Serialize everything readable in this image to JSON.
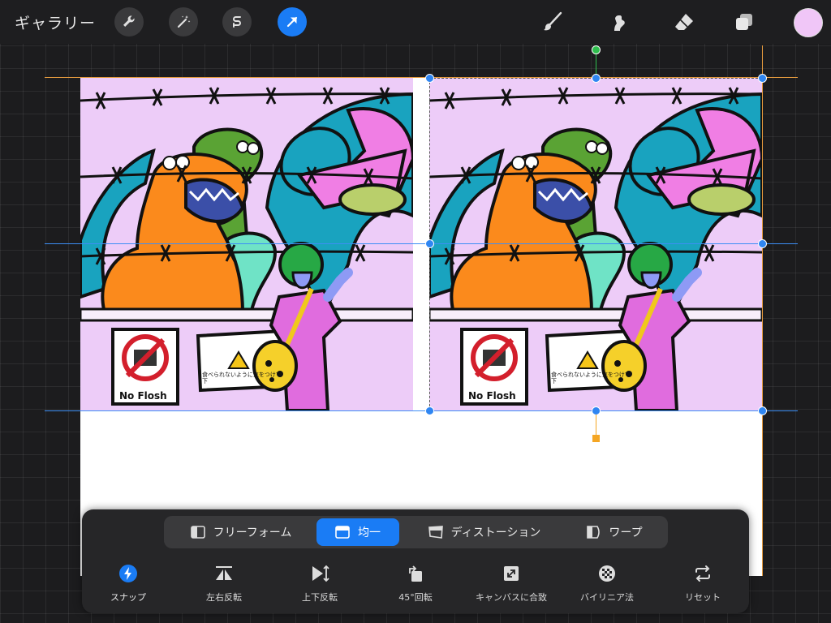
{
  "topbar": {
    "gallery_label": "ギャラリー",
    "tools_left": [
      "wrench-icon",
      "magic-wand-icon",
      "selection-s-icon",
      "arrow-transform-icon"
    ],
    "tools_right": [
      "brush-icon",
      "smudge-icon",
      "eraser-icon",
      "layers-icon"
    ],
    "active_tool": "arrow-transform-icon",
    "color_swatch": "#f0c6f7",
    "accent": "#1a7cf5"
  },
  "canvas": {
    "left_panel": {
      "sign_no_flash": "No Flosh",
      "sign_warning": "食べられないように気をつけて下"
    },
    "right_panel": {
      "sign_no_flash": "No Flosh",
      "sign_warning": "食べられないように気をつけて下"
    }
  },
  "transform": {
    "modes": [
      {
        "label": "フリーフォーム",
        "icon": "freeform-icon",
        "active": false
      },
      {
        "label": "均一",
        "icon": "uniform-icon",
        "active": true
      },
      {
        "label": "ディストーション",
        "icon": "distort-icon",
        "active": false
      },
      {
        "label": "ワープ",
        "icon": "warp-icon",
        "active": false
      }
    ],
    "actions": [
      {
        "label": "スナップ",
        "icon": "snap-icon",
        "active": true
      },
      {
        "label": "左右反転",
        "icon": "flip-horizontal-icon",
        "active": false
      },
      {
        "label": "上下反転",
        "icon": "flip-vertical-icon",
        "active": false
      },
      {
        "label": "45°回転",
        "icon": "rotate-45-icon",
        "active": false
      },
      {
        "label": "キャンバスに合致",
        "icon": "fit-to-canvas-icon",
        "active": false
      },
      {
        "label": "バイリニア法",
        "icon": "bilinear-icon",
        "active": false
      },
      {
        "label": "リセット",
        "icon": "reset-icon",
        "active": false
      }
    ]
  }
}
